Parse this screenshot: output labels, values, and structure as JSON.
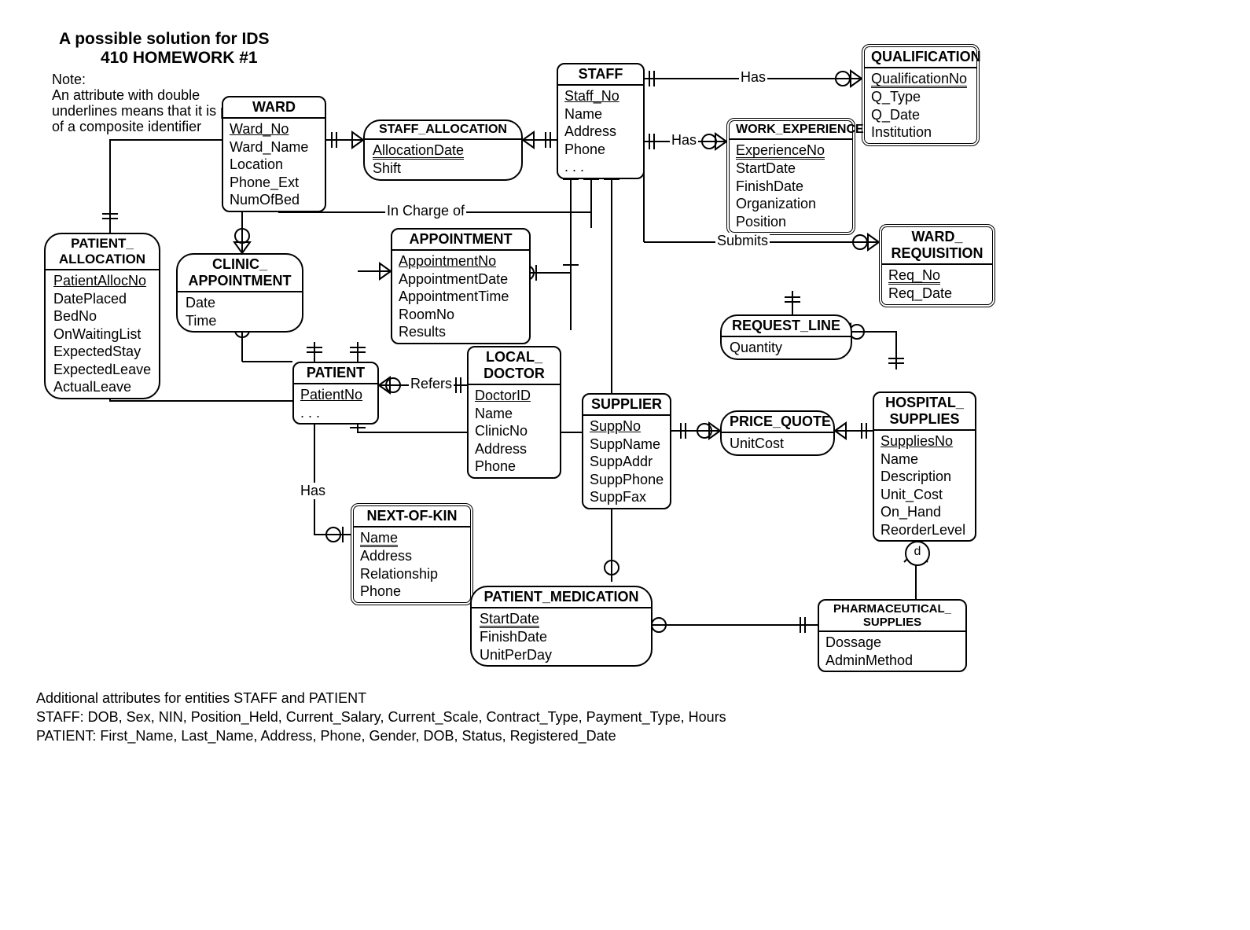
{
  "title1": "A possible solution for IDS",
  "title2": "410 HOMEWORK #1",
  "note1": "Note:",
  "note2": "An attribute with double",
  "note3": "underlines  means that it is part",
  "note4": "of a composite identifier",
  "footer_h": "Additional attributes for entities STAFF and PATIENT",
  "footer_staff": "STAFF: DOB, Sex, NIN, Position_Held, Current_Salary, Current_Scale, Contract_Type, Payment_Type, Hours",
  "footer_patient": "PATIENT: First_Name, Last_Name, Address, Phone, Gender, DOB, Status, Registered_Date",
  "ward": {
    "name": "WARD",
    "pk": "Ward_No",
    "a1": "Ward_Name",
    "a2": "Location",
    "a3": "Phone_Ext",
    "a4": "NumOfBed"
  },
  "staff": {
    "name": "STAFF",
    "pk": "Staff_No",
    "a1": "Name",
    "a2": "Address",
    "a3": "Phone",
    "a4": ". . ."
  },
  "qual": {
    "name": "QUALIFICATION",
    "pk": "QualificationNo",
    "a1": "Q_Type",
    "a2": "Q_Date",
    "a3": "Institution"
  },
  "wexp": {
    "name": "WORK_EXPERIENCE",
    "pk": "ExperienceNo",
    "a1": "StartDate",
    "a2": "FinishDate",
    "a3": "Organization",
    "a4": "Position"
  },
  "salloc": {
    "name": "STAFF_ALLOCATION",
    "pk": "AllocationDate",
    "a1": "Shift"
  },
  "palloc": {
    "name": "PATIENT_ ALLOCATION",
    "pk": "PatientAllocNo",
    "a1": "DatePlaced",
    "a2": "BedNo",
    "a3": "OnWaitingList",
    "a4": "ExpectedStay",
    "a5": "ExpectedLeave",
    "a6": "ActualLeave"
  },
  "cappt": {
    "name": "CLINIC_ APPOINTMENT",
    "a1": "Date",
    "a2": "Time"
  },
  "appt": {
    "name": "APPOINTMENT",
    "pk": "AppointmentNo",
    "a1": "AppointmentDate",
    "a2": "AppointmentTime",
    "a3": "RoomNo",
    "a4": "Results"
  },
  "patient": {
    "name": "PATIENT",
    "pk": "PatientNo",
    "a1": ". . ."
  },
  "ldoc": {
    "name": "LOCAL_ DOCTOR",
    "pk": "DoctorID",
    "a1": "Name",
    "a2": "ClinicNo",
    "a3": "Address",
    "a4": "Phone"
  },
  "nok": {
    "name": "NEXT-OF-KIN",
    "pk": "Name",
    "a1": "Address",
    "a2": "Relationship",
    "a3": "Phone"
  },
  "pmed": {
    "name": "PATIENT_MEDICATION",
    "pk": "StartDate",
    "a1": "FinishDate",
    "a2": "UnitPerDay"
  },
  "supp": {
    "name": "SUPPLIER",
    "pk": "SuppNo",
    "a1": "SuppName",
    "a2": "SuppAddr",
    "a3": "SuppPhone",
    "a4": "SuppFax"
  },
  "pquote": {
    "name": "PRICE_QUOTE",
    "a1": "UnitCost"
  },
  "hsupp": {
    "name": "HOSPITAL_ SUPPLIES",
    "pk": "SuppliesNo",
    "a1": "Name",
    "a2": "Description",
    "a3": "Unit_Cost",
    "a4": "On_Hand",
    "a5": "ReorderLevel"
  },
  "wreq": {
    "name": "WARD_ REQUISITION",
    "pk": "Req_No",
    "a1": "Req_Date"
  },
  "rline": {
    "name": "REQUEST_LINE",
    "a1": "Quantity"
  },
  "pharm": {
    "name": "PHARMACEUTICAL_ SUPPLIES",
    "a1": "Dossage",
    "a2": "AdminMethod"
  },
  "rel": {
    "has1": "Has",
    "has2": "Has",
    "has3": "Has",
    "incharge": "In Charge of",
    "refers": "Refers",
    "submits": "Submits",
    "d": "d"
  }
}
